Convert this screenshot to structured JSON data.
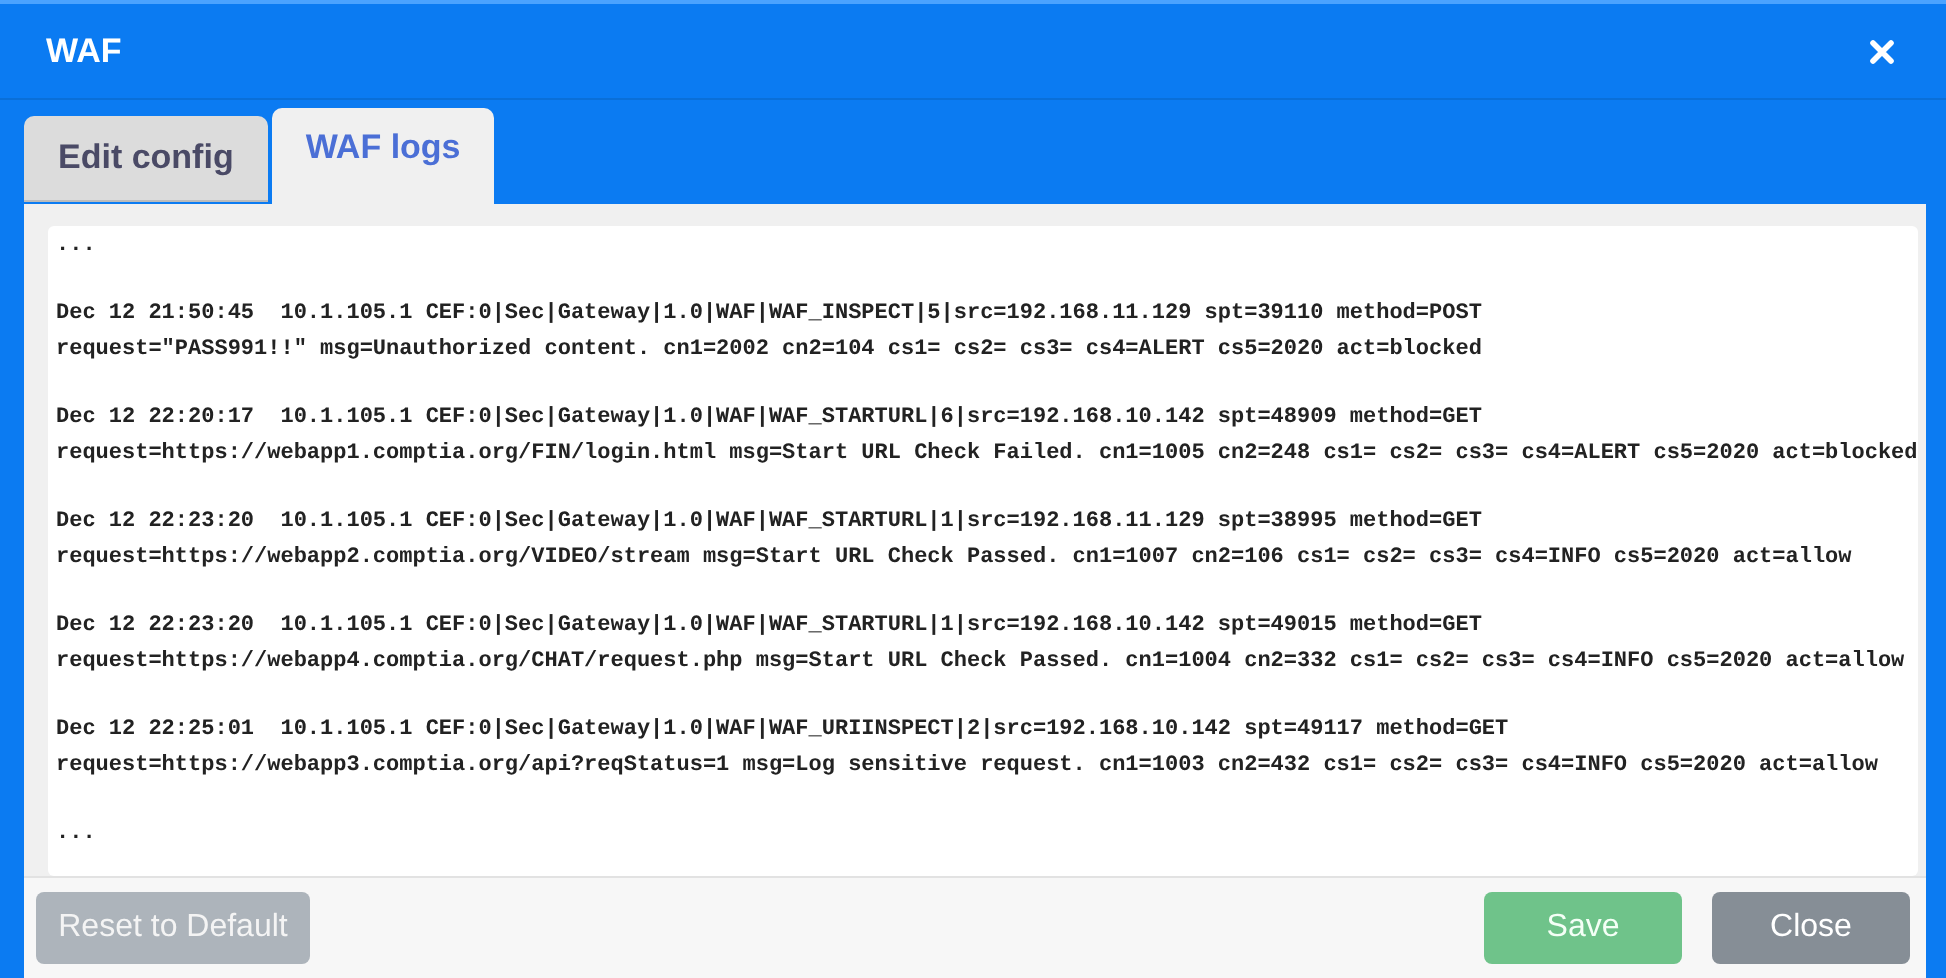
{
  "window": {
    "title": "WAF"
  },
  "tabs": [
    {
      "label": "Edit config",
      "selected": false
    },
    {
      "label": "WAF logs",
      "selected": true
    }
  ],
  "log": {
    "top": "...",
    "entries": [
      [
        "Dec 12 21:50:45  10.1.105.1 CEF:0|Sec|Gateway|1.0|WAF|WAF_INSPECT|5|src=192.168.11.129 spt=39110 method=POST",
        "request=\"PASS991!!\" msg=Unauthorized content. cn1=2002 cn2=104 cs1= cs2= cs3= cs4=ALERT cs5=2020 act=blocked"
      ],
      [
        "Dec 12 22:20:17  10.1.105.1 CEF:0|Sec|Gateway|1.0|WAF|WAF_STARTURL|6|src=192.168.10.142 spt=48909 method=GET",
        "request=https://webapp1.comptia.org/FIN/login.html msg=Start URL Check Failed. cn1=1005 cn2=248 cs1= cs2= cs3= cs4=ALERT cs5=2020 act=blocked"
      ],
      [
        "Dec 12 22:23:20  10.1.105.1 CEF:0|Sec|Gateway|1.0|WAF|WAF_STARTURL|1|src=192.168.11.129 spt=38995 method=GET",
        "request=https://webapp2.comptia.org/VIDEO/stream msg=Start URL Check Passed. cn1=1007 cn2=106 cs1= cs2= cs3= cs4=INFO cs5=2020 act=allow"
      ],
      [
        "Dec 12 22:23:20  10.1.105.1 CEF:0|Sec|Gateway|1.0|WAF|WAF_STARTURL|1|src=192.168.10.142 spt=49015 method=GET",
        "request=https://webapp4.comptia.org/CHAT/request.php msg=Start URL Check Passed. cn1=1004 cn2=332 cs1= cs2= cs3= cs4=INFO cs5=2020 act=allow"
      ],
      [
        "Dec 12 22:25:01  10.1.105.1 CEF:0|Sec|Gateway|1.0|WAF|WAF_URIINSPECT|2|src=192.168.10.142 spt=49117 method=GET",
        "request=https://webapp3.comptia.org/api?reqStatus=1 msg=Log sensitive request. cn1=1003 cn2=432 cs1= cs2= cs3= cs4=INFO cs5=2020 act=allow"
      ]
    ],
    "bottom": "..."
  },
  "buttons": [
    {
      "label": "Reset to Default",
      "kind": "secondary",
      "disabled": true
    },
    {
      "label": "Save",
      "kind": "success",
      "disabled": true
    },
    {
      "label": "Close",
      "kind": "secondary",
      "disabled": false
    }
  ]
}
